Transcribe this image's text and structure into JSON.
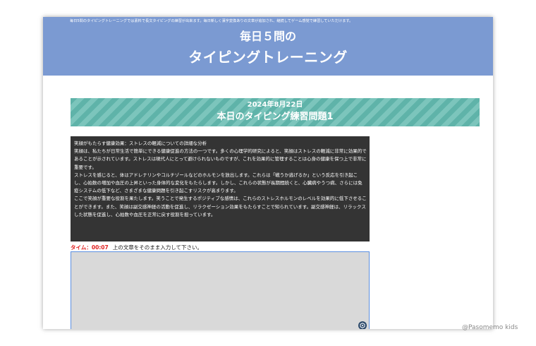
{
  "header": {
    "note": "毎日5問のタイピングトレーニングでは素料で長文タイピングの練習が出来ます。毎日新しく漢字変換ありの文章が追加され、継続してゲーム感覚で練習していただけます。",
    "title_line1": "毎日５問の",
    "title_line2": "タイピングトレーニング"
  },
  "banner": {
    "date": "2024年8月22日",
    "title": "本日のタイピング練習問題1"
  },
  "passage": {
    "lines": [
      "笑顔がもたらす健康効果：ストレスの軽減についての詳細な分析",
      "笑顔は、私たちが日常生活で簡単にできる健康促進の方法の一つです。多くの心理学的研究によると、笑顔はストレスの軽減に非常に効果的であることが示されています。ストレスは現代人にとって避けられないものですが、これを効果的に管理することは心身の健康を保つ上で非常に重要です。",
      "ストレスを感じると、体はアドレナリンやコルチゾールなどのホルモンを放出します。これらは「戦うか逃げるか」という反応を引き起こし、心拍数の増加や血圧の上昇といった身体的な変化をもたらします。しかし、これらの状態が長期間続くと、心臓病やうつ病、さらには免疫システムの低下など、さまざまな健康問題を引き起こすリスクが高まります。",
      "ここで笑顔が重要な役割を果たします。笑うことで発生するポジティブな感情は、これらのストレスホルモンのレベルを効果的に低下させることができます。また、笑顔は副交感神経の活動を促進し、リラクゼーション効果をもたらすことで知られています。副交感神経は、リラックスした状態を促進し、心拍数や血圧を正常に戻す役割を担っています。"
    ]
  },
  "status": {
    "timer_label": "タイム：",
    "timer_value": "00:07",
    "instruction": "上の文章をそのまま入力して下さい。"
  },
  "input": {
    "value": ""
  },
  "colors": {
    "header_bg": "#7b9ad2",
    "banner_stripe_a": "#5fb3a9",
    "banner_stripe_b": "#7cc5bc",
    "passage_bg": "#343434",
    "timer": "#e02020",
    "input_border": "#5b8fe0"
  },
  "icons": {
    "resize_badge": "grammar-check-icon"
  },
  "credit": "@Pasomemo kids"
}
